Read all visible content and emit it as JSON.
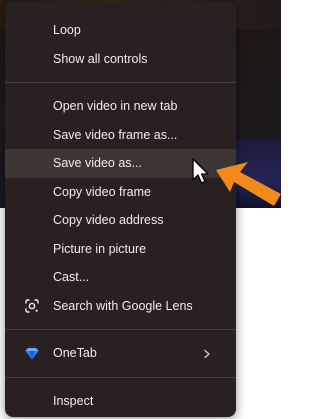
{
  "menu": {
    "groups": [
      [
        {
          "label": "Loop"
        },
        {
          "label": "Show all controls"
        }
      ],
      [
        {
          "label": "Open video in new tab"
        },
        {
          "label": "Save video frame as..."
        },
        {
          "label": "Save video as...",
          "highlighted": true
        },
        {
          "label": "Copy video frame"
        },
        {
          "label": "Copy video address"
        },
        {
          "label": "Picture in picture"
        },
        {
          "label": "Cast..."
        },
        {
          "label": "Search with Google Lens",
          "icon": "google-lens-icon"
        }
      ],
      [
        {
          "label": "OneTab",
          "icon": "onetab-diamond-icon",
          "submenu": true
        }
      ],
      [
        {
          "label": "Inspect"
        }
      ]
    ]
  },
  "colors": {
    "menu_bg": "#292121",
    "highlight_bg": "#3d3434",
    "text": "#f1ecec",
    "arrow": "#f28a1b",
    "onetab": "#2f7df6"
  }
}
